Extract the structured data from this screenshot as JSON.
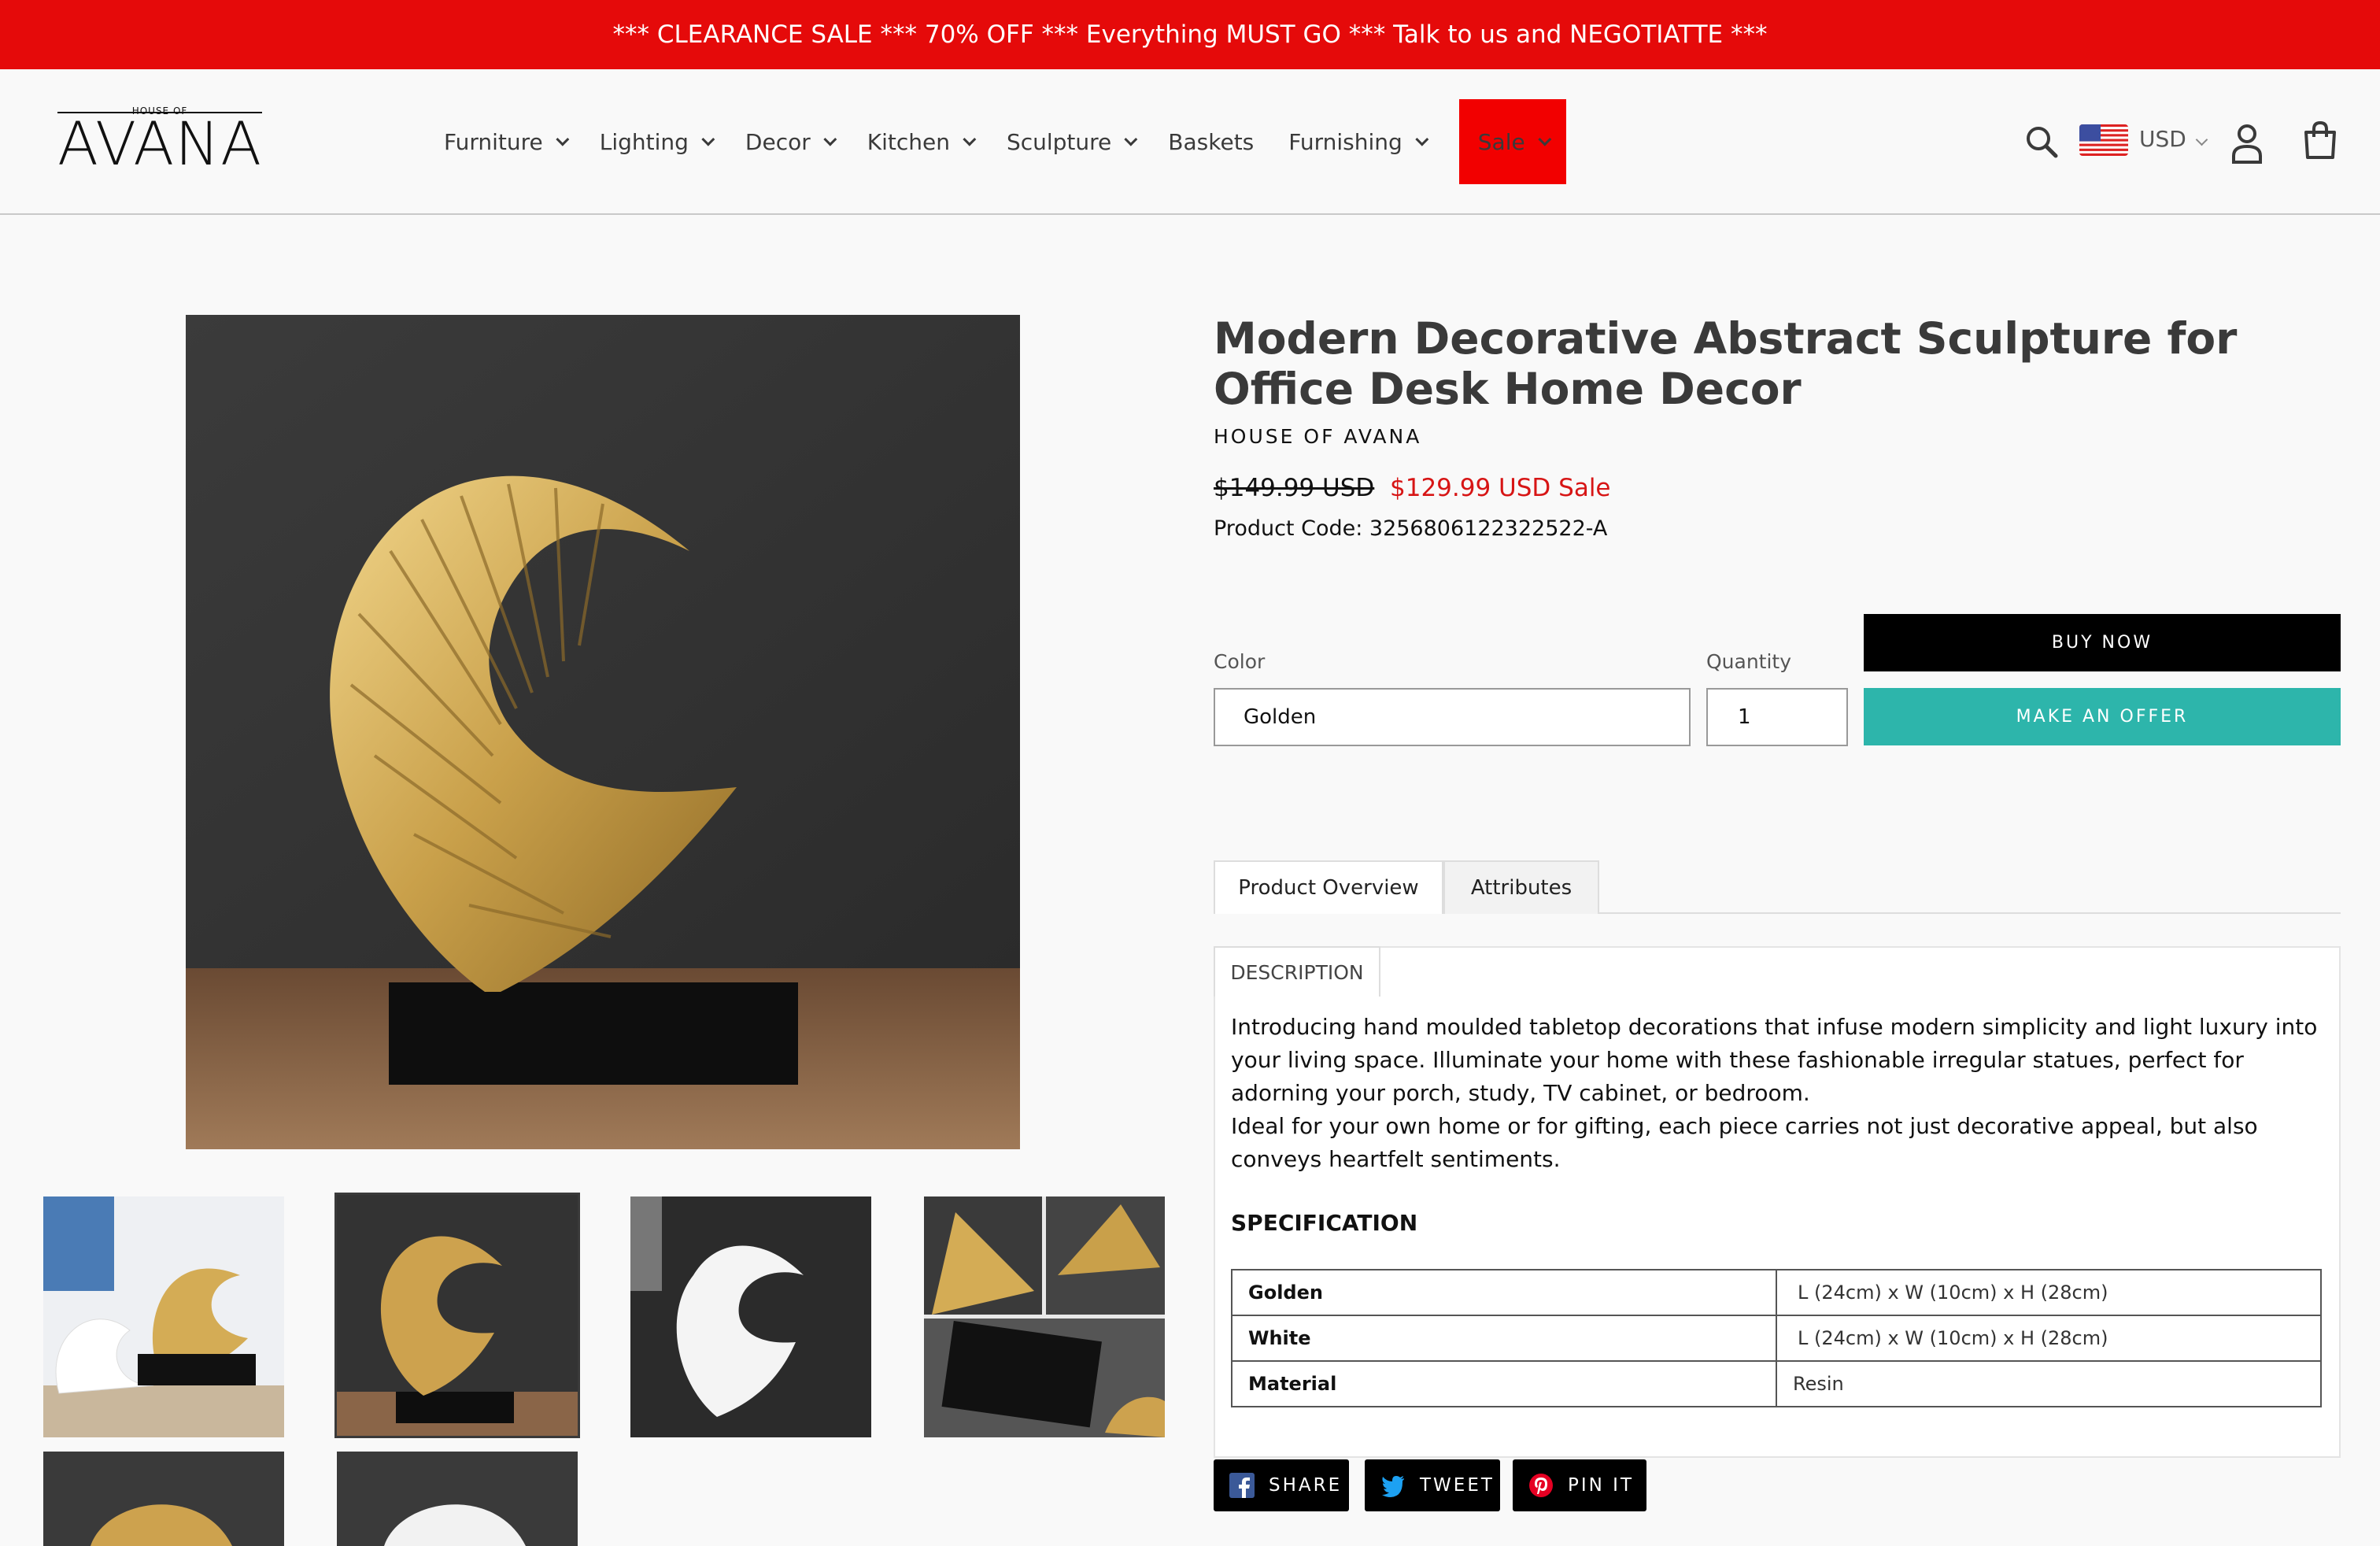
{
  "announcement": "*** CLEARANCE SALE *** 70% OFF *** Everything MUST GO *** Talk to us and NEGOTIATTE ***",
  "logo": {
    "top": "HOUSE OF",
    "word": "AVANA"
  },
  "nav": {
    "items": [
      {
        "label": "Furniture",
        "has_dropdown": true
      },
      {
        "label": "Lighting",
        "has_dropdown": true
      },
      {
        "label": "Decor",
        "has_dropdown": true
      },
      {
        "label": "Kitchen",
        "has_dropdown": true
      },
      {
        "label": "Sculpture",
        "has_dropdown": true
      },
      {
        "label": "Baskets",
        "has_dropdown": false
      },
      {
        "label": "Furnishing",
        "has_dropdown": true
      },
      {
        "label": "Sale",
        "has_dropdown": true,
        "highlight": "#f20000"
      }
    ]
  },
  "header_icons": {
    "search": "search-icon",
    "flag": "us-flag-icon",
    "currency": "USD",
    "account": "account-icon",
    "cart": "cart-icon"
  },
  "product": {
    "title": "Modern Decorative Abstract Sculpture for Office Desk Home Decor",
    "vendor": "HOUSE OF AVANA",
    "price_old": "$149.99 USD",
    "price_new": "$129.99 USD Sale",
    "code": "Product Code: 3256806122322522-A"
  },
  "options": {
    "color_label": "Color",
    "color_value": "Golden",
    "quantity_label": "Quantity",
    "quantity_value": "1"
  },
  "buttons": {
    "buy_now": "BUY NOW",
    "make_offer": "MAKE AN OFFER"
  },
  "tabs": [
    {
      "label": "Product Overview",
      "active": true
    },
    {
      "label": "Attributes",
      "active": false
    }
  ],
  "description": {
    "tab_label": "DESCRIPTION",
    "paragraph1": "Introducing hand moulded tabletop decorations that infuse modern simplicity and light luxury into your living space. Illuminate your home with these fashionable irregular statues, perfect for adorning your porch, study, TV cabinet, or bedroom.",
    "paragraph2": "Ideal for your own home or for gifting, each piece carries not just decorative appeal, but also conveys heartfelt sentiments.",
    "spec_heading": "SPECIFICATION",
    "spec_rows": [
      {
        "key": "Golden",
        "value": "L (24cm) x W (10cm) x H (28cm)"
      },
      {
        "key": "White",
        "value": "L (24cm) x W (10cm) x H (28cm)"
      },
      {
        "key": "Material",
        "value": "Resin"
      }
    ]
  },
  "share": [
    {
      "label": "SHARE",
      "icon": "facebook-icon",
      "color": "#3b5998"
    },
    {
      "label": "TWEET",
      "icon": "twitter-icon",
      "color": "#1da1f2"
    },
    {
      "label": "PIN IT",
      "icon": "pinterest-icon",
      "color": "#e60023"
    }
  ],
  "colors": {
    "announcement_bg": "#e50a0a",
    "accent": "#2db5ab",
    "sale_price": "#d71515"
  }
}
